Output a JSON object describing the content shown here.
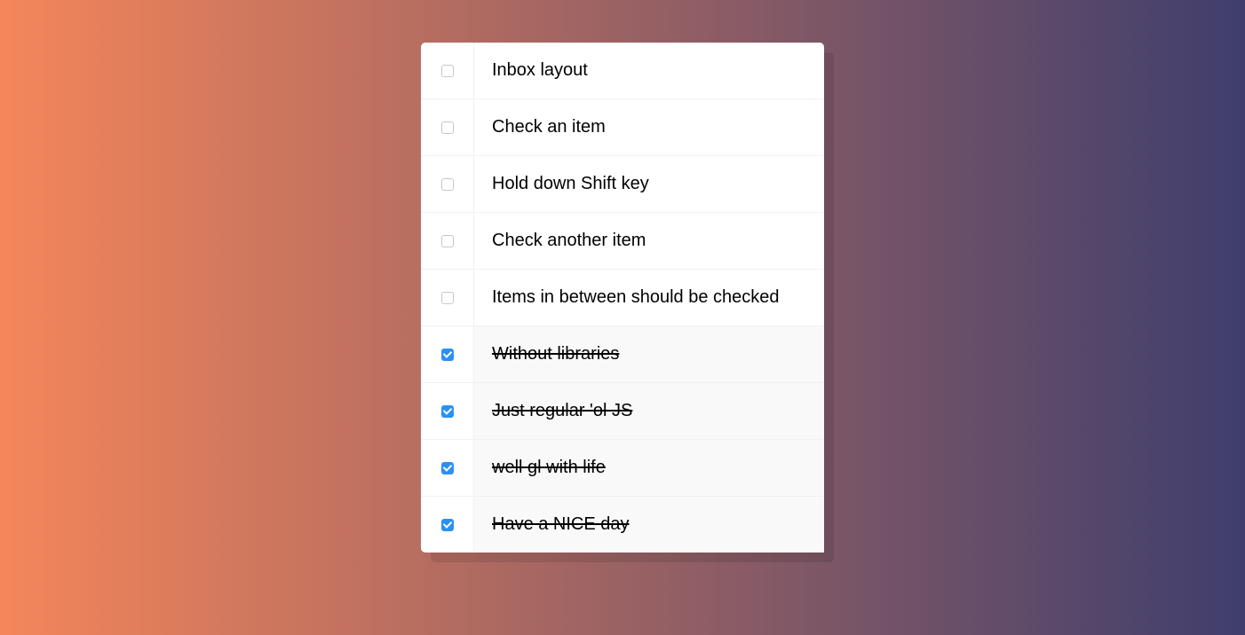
{
  "items": [
    {
      "text": "Inbox layout",
      "checked": false
    },
    {
      "text": "Check an item",
      "checked": false
    },
    {
      "text": "Hold down Shift key",
      "checked": false
    },
    {
      "text": "Check another item",
      "checked": false
    },
    {
      "text": "Items in between should be checked",
      "checked": false
    },
    {
      "text": "Without libraries",
      "checked": true
    },
    {
      "text": "Just regular 'ol JS",
      "checked": true
    },
    {
      "text": "well gl with life",
      "checked": true
    },
    {
      "text": "Have a NICE day",
      "checked": true
    }
  ]
}
